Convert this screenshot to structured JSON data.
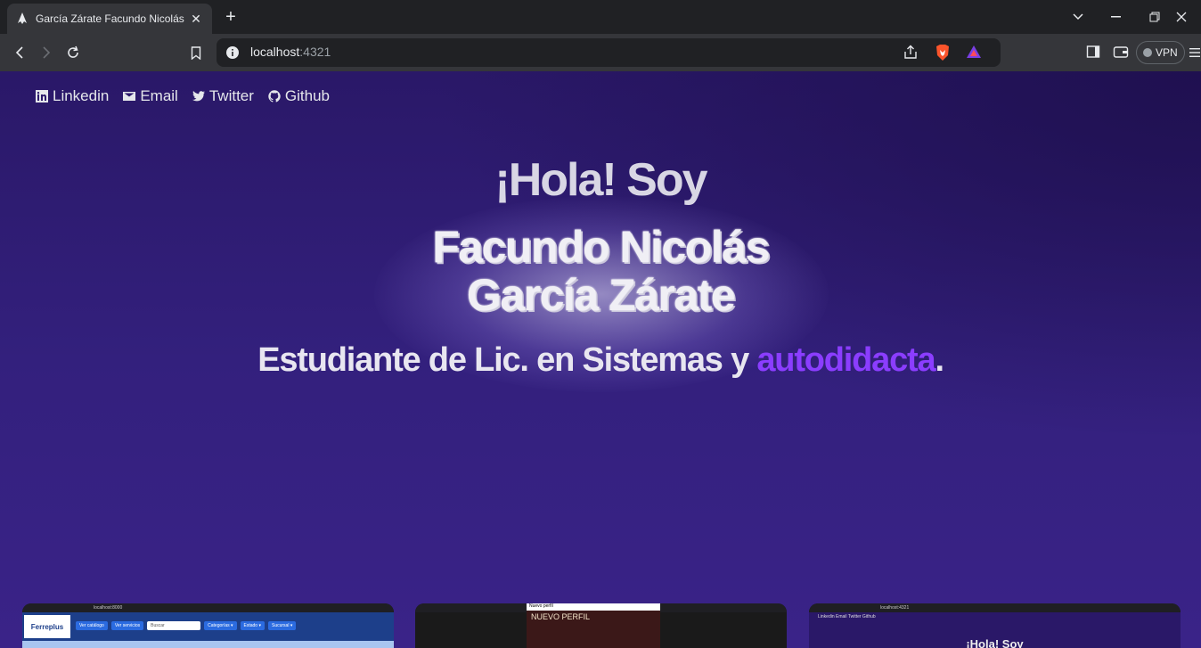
{
  "browser": {
    "tab_title": "García Zárate Facundo Nicolás",
    "url_host": "localhost",
    "url_port": ":4321",
    "vpn_label": "VPN"
  },
  "socials": [
    {
      "label": "Linkedin",
      "icon": "linkedin-icon"
    },
    {
      "label": "Email",
      "icon": "email-icon"
    },
    {
      "label": "Twitter",
      "icon": "twitter-icon"
    },
    {
      "label": "Github",
      "icon": "github-icon"
    }
  ],
  "hero": {
    "greeting": "¡Hola! Soy",
    "name_line1": "Facundo Nicolás",
    "name_line2": "García Zárate",
    "subtitle_pre": "Estudiante de Lic. en Sistemas y ",
    "subtitle_accent": "autodidacta",
    "subtitle_post": "."
  },
  "projects": {
    "card1": {
      "url": "localhost:8000",
      "logo": "Ferreplus",
      "buttons": [
        "Ver catálogo",
        "Ver servicios",
        "Buscar",
        "Categorías ▾",
        "Estado ▾",
        "Sucursal ▾"
      ]
    },
    "card2": {
      "window_title": "Nuevo perfil",
      "heading": "NUEVO PERFIL"
    },
    "card3": {
      "url": "localhost:4321",
      "socials": "Linkedin  Email  Twitter  Github",
      "greeting": "¡Hola! Soy"
    }
  },
  "colors": {
    "accent": "#8b3dff",
    "background": "#33207d"
  }
}
